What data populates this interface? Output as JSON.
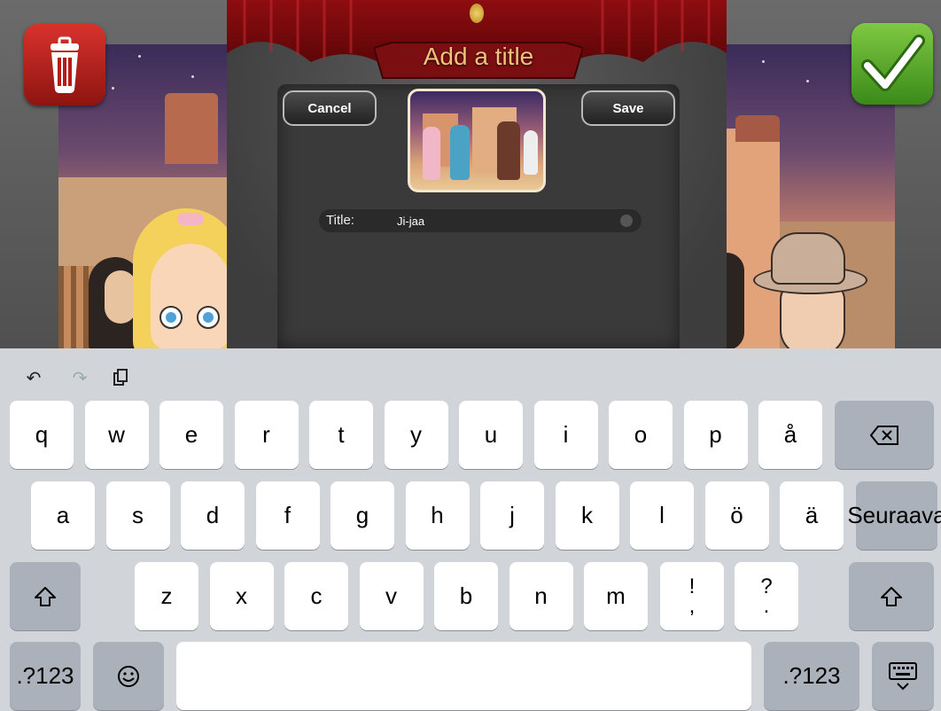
{
  "modal": {
    "title": "Add a title",
    "cancel_label": "Cancel",
    "save_label": "Save",
    "title_field_label": "Title:",
    "title_field_value": "Ji-jaa"
  },
  "scene": {
    "trash_icon": "trash-icon",
    "confirm_icon": "checkmark-icon"
  },
  "keyboard": {
    "toolbar": [
      "undo-icon",
      "redo-icon",
      "paste-icon"
    ],
    "row1": [
      "q",
      "w",
      "e",
      "r",
      "t",
      "y",
      "u",
      "i",
      "o",
      "p",
      "å"
    ],
    "row2": [
      "a",
      "s",
      "d",
      "f",
      "g",
      "h",
      "j",
      "k",
      "l",
      "ö",
      "ä"
    ],
    "row3": [
      "z",
      "x",
      "c",
      "v",
      "b",
      "n",
      "m"
    ],
    "punct1_top": "!",
    "punct1_bottom": ",",
    "punct2_top": "?",
    "punct2_bottom": ".",
    "return_label": "Seuraava",
    "numbers_label": ".?123",
    "emoji_icon": "emoji-icon",
    "dismiss_icon": "keyboard-dismiss-icon"
  },
  "colors": {
    "keyboard_bg": "#d1d4d9",
    "key_bg": "#ffffff",
    "func_key_bg": "#abb1ba",
    "title_text": "#f0c27a",
    "trash_red": "#c62520",
    "confirm_green": "#5aa82e"
  }
}
